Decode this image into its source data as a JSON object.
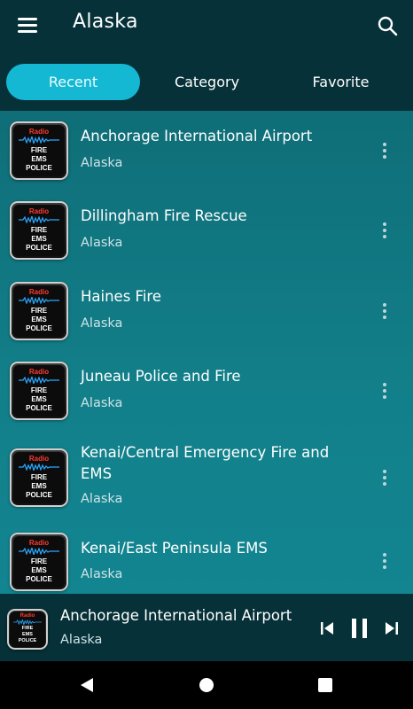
{
  "app": {
    "title": "Alaska"
  },
  "tabs": [
    {
      "label": "Recent",
      "active": true
    },
    {
      "label": "Category",
      "active": false
    },
    {
      "label": "Favorite",
      "active": false
    }
  ],
  "logo": {
    "radio": "Radio",
    "line1": "FIRE",
    "line2": "EMS",
    "line3": "POLICE"
  },
  "stations": [
    {
      "name": "Anchorage International Airport",
      "region": "Alaska"
    },
    {
      "name": "Dillingham Fire Rescue",
      "region": "Alaska"
    },
    {
      "name": "Haines Fire",
      "region": "Alaska"
    },
    {
      "name": "Juneau Police and Fire",
      "region": "Alaska"
    },
    {
      "name": "Kenai/Central Emergency Fire and EMS",
      "region": "Alaska"
    },
    {
      "name": "Kenai/East Peninsula EMS",
      "region": "Alaska"
    }
  ],
  "player": {
    "title": "Anchorage International Airport",
    "subtitle": "Alaska",
    "state": "playing"
  },
  "colors": {
    "appbar": "#063138",
    "list_bg": "#0f6b74",
    "active_tab": "#14b8d3",
    "logo_red": "#ff3b2f"
  },
  "icons": [
    "menu-icon",
    "search-icon",
    "more-vert-icon",
    "skip-previous-icon",
    "pause-icon",
    "skip-next-icon",
    "back-icon",
    "home-icon",
    "recents-icon"
  ]
}
